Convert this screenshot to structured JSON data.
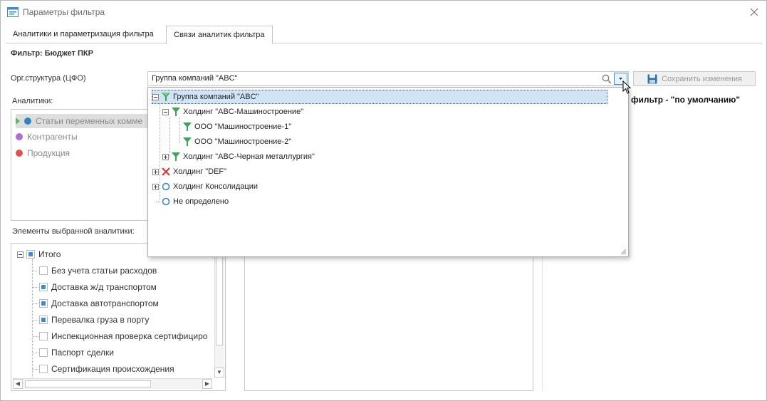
{
  "window": {
    "title": "Параметры фильтра"
  },
  "tabs": [
    {
      "label": "Аналитики и параметризация фильтра",
      "active": false
    },
    {
      "label": "Связи аналитик фильтра",
      "active": true
    }
  ],
  "filter": {
    "label": "Фильтр: Бюджет ПКР"
  },
  "org": {
    "label": "Орг.структура (ЦФО)",
    "value": "Группа компаний \"ABC\""
  },
  "toolbar": {
    "save_label": "Сохранить изменения"
  },
  "right_note": "фильтр - \"по умолчанию\"",
  "analytics": {
    "label": "Аналитики:",
    "items": [
      {
        "label": "Статьи переменных комме",
        "color": "#2e86c1"
      },
      {
        "label": "Контрагенты",
        "color": "#b36bd1"
      },
      {
        "label": "Продукция",
        "color": "#e05050"
      }
    ]
  },
  "elements": {
    "label": "Элементы выбранной аналитики:",
    "root": {
      "label": "Итого"
    },
    "items": [
      {
        "label": "Без учета статьи расходов",
        "checked": false
      },
      {
        "label": "Доставка ж/д транспортом",
        "checked": true
      },
      {
        "label": "Доставка автотранспортом",
        "checked": true
      },
      {
        "label": "Перевалка груза в порту",
        "checked": true
      },
      {
        "label": "Инспекционная проверка сертифициро",
        "checked": false
      },
      {
        "label": "Паспорт сделки",
        "checked": false
      },
      {
        "label": "Сертификация происхождения",
        "checked": false
      }
    ]
  },
  "dropdown": {
    "rows": [
      {
        "label": "Группа компаний \"ABC\"",
        "icon": "filter-icon"
      },
      {
        "label": "Холдинг \"ABC-Машиностроение\"",
        "icon": "filter-icon"
      },
      {
        "label": "ООО \"Машиностроение-1\"",
        "icon": "filter-icon"
      },
      {
        "label": "ООО \"Машиностроение-2\"",
        "icon": "filter-icon"
      },
      {
        "label": "Холдинг \"ABC-Черная металлургия\"",
        "icon": "filter-icon"
      },
      {
        "label": "Холдинг \"DEF\"",
        "icon": "cross-icon"
      },
      {
        "label": "Холдинг Консолидации",
        "icon": "circle-icon"
      },
      {
        "label": "Не определено",
        "icon": "circle-icon"
      }
    ]
  },
  "colors": {
    "accent": "#3a8ed0",
    "filter_green": "#3aa757",
    "cross_red": "#e03030",
    "circle_blue": "#2e86c1",
    "selected_row": "#cfe5f7"
  }
}
